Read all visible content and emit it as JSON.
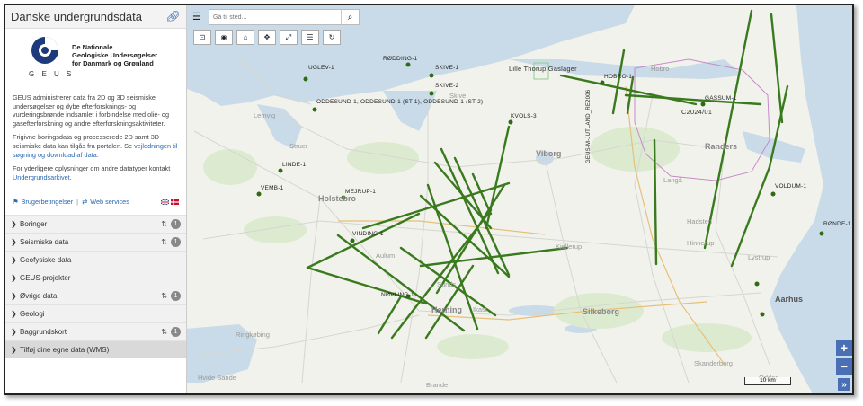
{
  "app": {
    "title": "Danske undergrundsdata"
  },
  "logo": {
    "org_line1": "De Nationale",
    "org_line2": "Geologiske Undersøgelser",
    "org_line3": "for Danmark og Grønland",
    "wordmark": "G E U S"
  },
  "intro": {
    "p1": "GEUS administrerer data fra 2D og 3D seismiske undersøgelser og dybe efterforsknings- og vurderingsbrønde indsamlet i forbindelse med olie- og gasefterforskning og andre efterforskningsaktiviteter.",
    "p2_a": "Frigivne boringsdata og processerede 2D samt 3D seismiske data kan tilgås fra portalen. Se ",
    "p2_link": "vejledningen til søgning og download af data",
    "p2_b": ".",
    "p3_a": "For yderligere oplysninger om andre datatyper kontakt ",
    "p3_link": "Undergrundsarkivet",
    "p3_b": "."
  },
  "links": {
    "terms": "Brugerbetingelser",
    "separator": "|",
    "web": "Web services"
  },
  "layers": [
    {
      "label": "Boringer",
      "count": "1",
      "sortable": true
    },
    {
      "label": "Seismiske data",
      "count": "1",
      "sortable": true
    },
    {
      "label": "Geofysiske data",
      "count": "",
      "sortable": false
    },
    {
      "label": "GEUS-projekter",
      "count": "",
      "sortable": false
    },
    {
      "label": "Øvrige data",
      "count": "1",
      "sortable": true
    },
    {
      "label": "Geologi",
      "count": "",
      "sortable": false
    },
    {
      "label": "Baggrundskort",
      "count": "1",
      "sortable": true
    },
    {
      "label": "Tilføj dine egne data (WMS)",
      "count": "",
      "sortable": false
    }
  ],
  "search": {
    "placeholder": "Gå til sted..."
  },
  "map": {
    "scale": "10 km",
    "wells": [
      "RØDDING-1",
      "UGLEV-1",
      "SKIVE-1",
      "SKIVE-2",
      "HOBRO-1",
      "GASSUM-1",
      "ODDESUND-1, ODDESUND-1 (ST 1), ODDESUND-1 (ST 2)",
      "KVOLS-3",
      "LINDE-1",
      "VEMB-1",
      "MEJRUP-1",
      "VOLDUM-1",
      "RØNDE-1",
      "VINDING-1",
      "NØVLING-1"
    ],
    "seismic_labels": [
      "Lille Thorup Gaslager",
      "C2024/01",
      "GEUS-M-JUTLAND_RE2006"
    ],
    "towns": [
      "Lemvig",
      "Struer",
      "Holstebro",
      "Skive",
      "Viborg",
      "Randers",
      "Silkeborg",
      "Herning",
      "Ikast",
      "Aarhus",
      "Ringkøbing",
      "Skanderborg",
      "Odder",
      "Hvide Sande",
      "Aulum",
      "Sunds",
      "Kjellerup",
      "Hadsten",
      "Hinnerup",
      "Lystrup",
      "Brande",
      "Langå",
      "Hobro"
    ],
    "line_color": "#3a7a1e"
  },
  "zoom": {
    "in": "+",
    "out": "−",
    "expand": "»"
  }
}
